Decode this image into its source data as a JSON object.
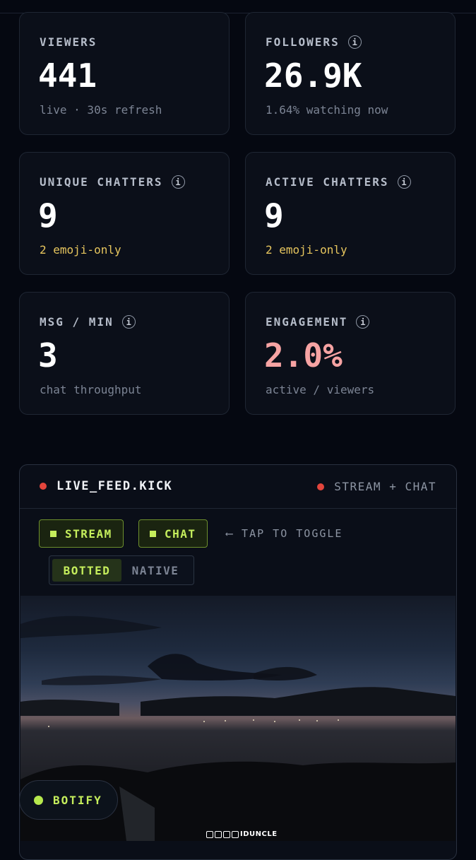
{
  "stats": [
    {
      "label": "VIEWERS",
      "value": "441",
      "sub": "live · 30s refresh"
    },
    {
      "label": "FOLLOWERS",
      "value": "26.9K",
      "sub": "1.64% watching now"
    },
    {
      "label": "UNIQUE CHATTERS",
      "value": "9",
      "sub": "2 emoji-only"
    },
    {
      "label": "ACTIVE CHATTERS",
      "value": "9",
      "sub": "2 emoji-only"
    },
    {
      "label": "MSG / MIN",
      "value": "3",
      "sub": "chat throughput"
    },
    {
      "label": "ENGAGEMENT",
      "value": "2.0%",
      "sub": "active / viewers"
    }
  ],
  "info_glyph": "i",
  "feed": {
    "title": "LIVE_FEED.KICK",
    "mode": "STREAM + CHAT",
    "stream_btn": "STREAM",
    "chat_btn": "CHAT",
    "tap_hint": "⟵ TAP TO TOGGLE",
    "seg_botted": "BOTTED",
    "seg_native": "NATIVE"
  },
  "botify_label": "BOTIFY",
  "watermark": "IDUNCLE",
  "colors": {
    "accent_green": "#c5ee5c",
    "live_red": "#e2453c",
    "highlight_yellow": "#e7c65e",
    "engagement_pink": "#f6a3a3"
  }
}
